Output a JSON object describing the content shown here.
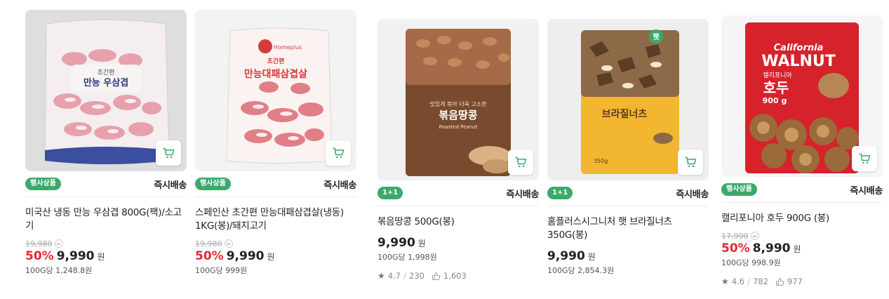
{
  "products": [
    {
      "badge": "행사상품",
      "delivery": "즉시배송",
      "name": "미국산 냉동 만능 우삼겹 800G(팩)/소고기",
      "original_price": "19,980",
      "discount": "50%",
      "price": "9,990",
      "won": "원",
      "unit_price": "100G당 1,248.8원",
      "package_text": [
        "초간편",
        "만능 우삼겹"
      ]
    },
    {
      "badge": "행사상품",
      "delivery": "즉시배송",
      "name": "스페인산 초간편 만능대패삼겹살(냉동) 1KG(봉)/돼지고기",
      "original_price": "19,980",
      "discount": "50%",
      "price": "9,990",
      "won": "원",
      "unit_price": "100G당 999원",
      "package_text": [
        "Homeplus",
        "초간편",
        "만능대패삼겹살"
      ]
    },
    {
      "badge": "1+1",
      "delivery": "즉시배송",
      "name": "볶음땅콩 500G(봉)",
      "price": "9,990",
      "won": "원",
      "unit_price": "100G당 1,998원",
      "rating": "4.7",
      "reviews": "230",
      "likes": "1,603",
      "package_text": [
        "맛있게 볶아 더욱 고소한",
        "볶음땅콩",
        "Roasted Peanut"
      ]
    },
    {
      "badge": "1+1",
      "delivery": "즉시배송",
      "name": "홈플러스시그니처 햇 브라질너츠 350G(봉)",
      "price": "9,990",
      "won": "원",
      "unit_price": "100G당 2,854.3원",
      "package_text": [
        "햇",
        "브라질너츠",
        "350g"
      ]
    },
    {
      "badge": "행사상품",
      "delivery": "즉시배송",
      "name": "캘리포니아 호두 900G (봉)",
      "original_price": "17,990",
      "discount": "50%",
      "price": "8,990",
      "won": "원",
      "unit_price": "100G당 998.9원",
      "rating": "4.6",
      "reviews": "782",
      "likes": "977",
      "package_text": [
        "California",
        "WALNUT",
        "캘리포니아",
        "호두",
        "900 g"
      ]
    }
  ],
  "icons": {
    "cart": "cart-icon",
    "star": "star-icon",
    "like": "like-icon",
    "chevron": "chevron-down-icon"
  },
  "colors": {
    "badge_green": "#3ca96b",
    "discount_red": "#e4282f",
    "cart_green": "#3ca96b"
  }
}
